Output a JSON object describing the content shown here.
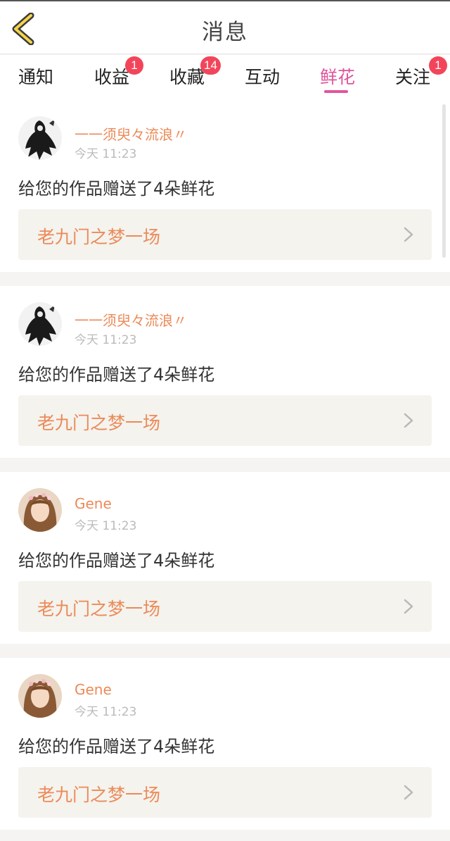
{
  "header": {
    "title": "消息",
    "back_icon": "chevron-left-icon"
  },
  "tabs": [
    {
      "label": "通知",
      "badge": ""
    },
    {
      "label": "收益",
      "badge": "1"
    },
    {
      "label": "收藏",
      "badge": "14"
    },
    {
      "label": "互动",
      "badge": ""
    },
    {
      "label": "鲜花",
      "badge": "",
      "active": true
    },
    {
      "label": "关注",
      "badge": "1"
    }
  ],
  "colors": {
    "accent": "#e0559b",
    "badge": "#f2455a",
    "name": "#ec8a58"
  },
  "items": [
    {
      "name": "一一须臾々流浪〃",
      "time": "今天 11:23",
      "message": "给您的作品赠送了4朵鲜花",
      "work": "老九门之梦一场",
      "avatar": "ink-figure-avatar"
    },
    {
      "name": "一一须臾々流浪〃",
      "time": "今天 11:23",
      "message": "给您的作品赠送了4朵鲜花",
      "work": "老九门之梦一场",
      "avatar": "ink-figure-avatar"
    },
    {
      "name": "Gene",
      "time": "今天 11:23",
      "message": "给您的作品赠送了4朵鲜花",
      "work": "老九门之梦一场",
      "avatar": "girl-photo-avatar"
    },
    {
      "name": "Gene",
      "time": "今天 11:23",
      "message": "给您的作品赠送了4朵鲜花",
      "work": "老九门之梦一场",
      "avatar": "girl-photo-avatar"
    }
  ]
}
